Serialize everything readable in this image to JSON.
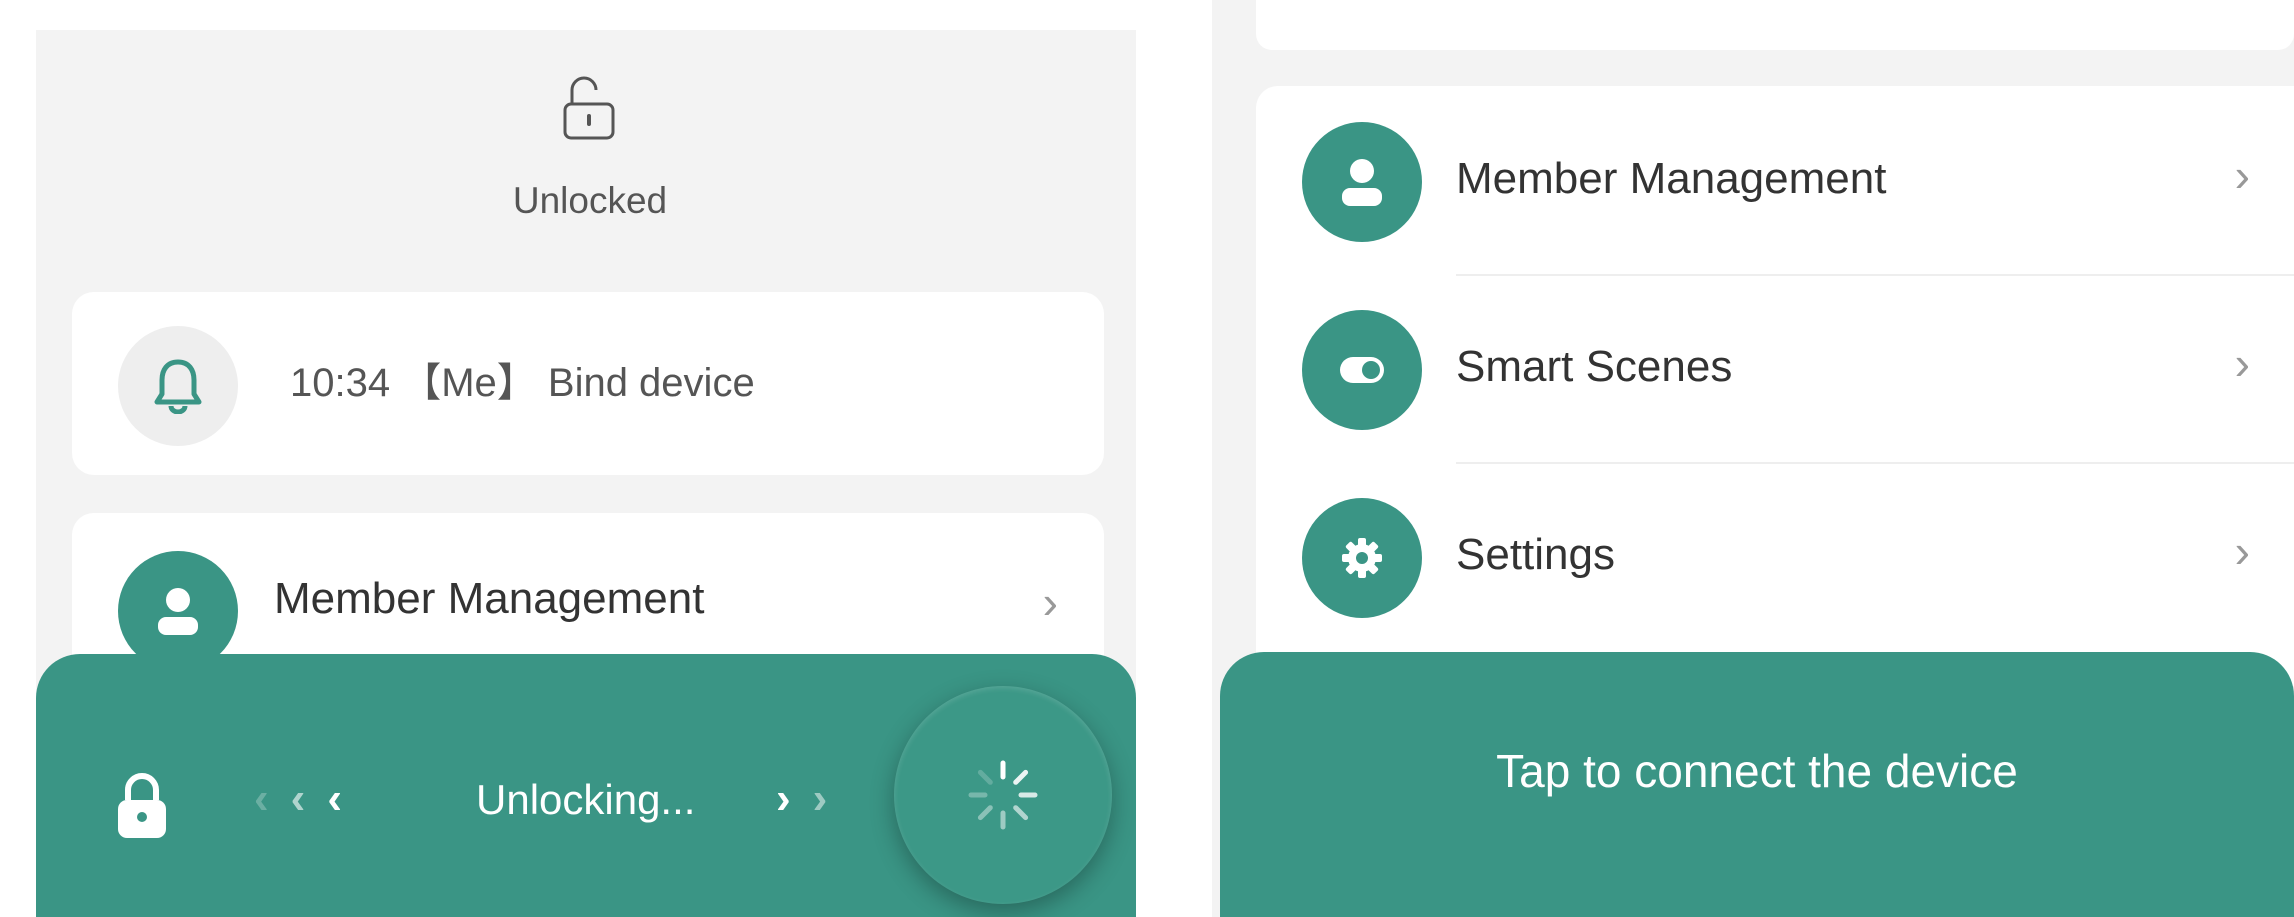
{
  "colors": {
    "accent": "#3a9585",
    "panel_bg": "#f3f3f3",
    "card_bg": "#ffffff"
  },
  "left": {
    "status": {
      "icon": "unlocked-padlock-icon",
      "label": "Unlocked"
    },
    "log": {
      "icon": "bell-icon",
      "text": "10:34 【Me】 Bind device"
    },
    "member_item": {
      "icon": "person-icon",
      "label": "Member Management",
      "chevron": "›"
    },
    "unlock_bar": {
      "lock_icon": "padlock-icon",
      "arrows_left": "‹‹‹",
      "label": "Unlocking...",
      "arrows_right": "››",
      "knob_icon": "loading-spinner-icon"
    }
  },
  "right": {
    "menu": [
      {
        "icon": "person-icon",
        "label": "Member Management",
        "chevron": "›"
      },
      {
        "icon": "toggle-icon",
        "label": "Smart Scenes",
        "chevron": "›"
      },
      {
        "icon": "gear-icon",
        "label": "Settings",
        "chevron": "›"
      }
    ],
    "connect_bar": {
      "label": "Tap to connect the device"
    }
  }
}
